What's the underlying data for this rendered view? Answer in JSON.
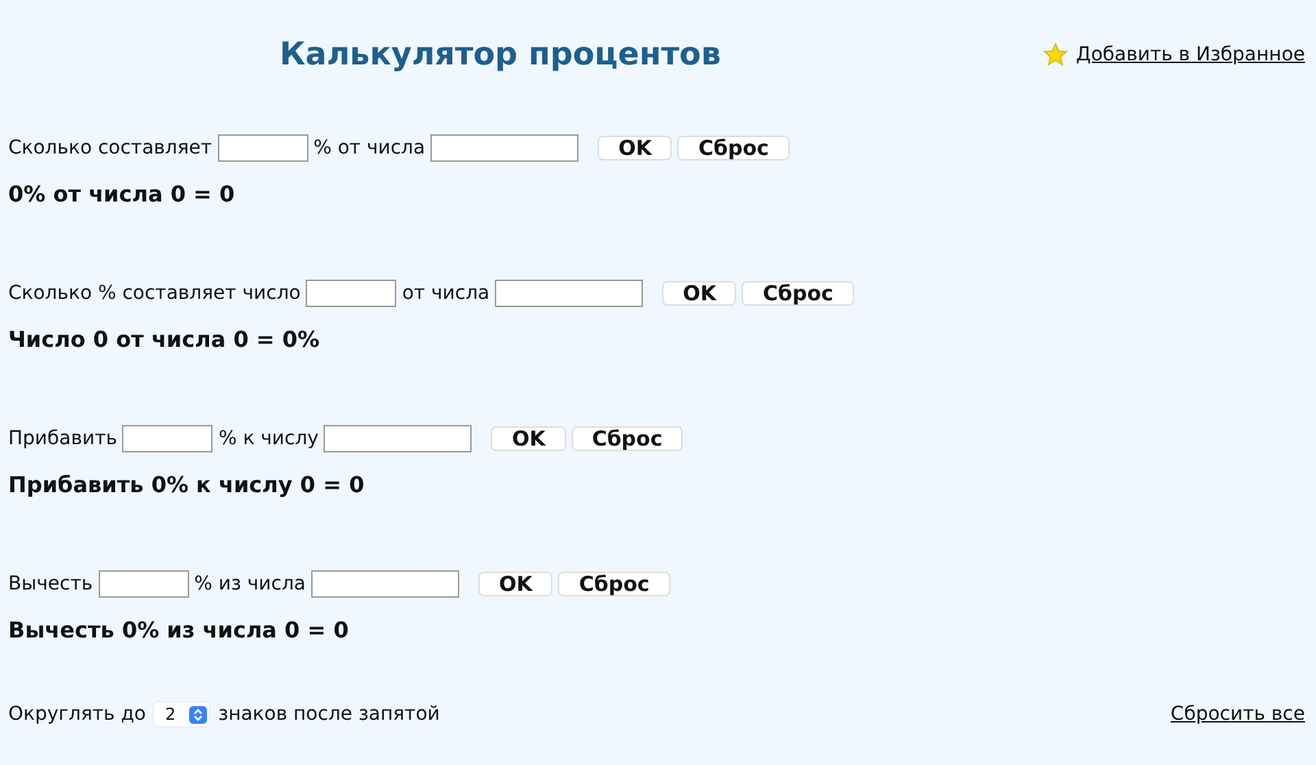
{
  "title": "Калькулятор процентов",
  "favorite_link": "Добавить в Избранное",
  "calculators": [
    {
      "label_before": "Сколько составляет",
      "label_middle": "% от числа",
      "ok_button": "OK",
      "reset_button": "Сброс",
      "result": "0% от числа 0 = 0"
    },
    {
      "label_before": "Сколько % составляет число",
      "label_middle": "от числа",
      "ok_button": "OK",
      "reset_button": "Сброс",
      "result": "Число 0 от числа 0 = 0%"
    },
    {
      "label_before": "Прибавить",
      "label_middle": "% к числу",
      "ok_button": "OK",
      "reset_button": "Сброс",
      "result": "Прибавить 0% к числу 0 = 0"
    },
    {
      "label_before": "Вычесть",
      "label_middle": "% из числа",
      "ok_button": "OK",
      "reset_button": "Сброс",
      "result": "Вычесть 0% из числа 0 = 0"
    }
  ],
  "rounding": {
    "label_before": "Округлять до",
    "value": "2",
    "label_after": "знаков после запятой"
  },
  "reset_all_link": "Сбросить все"
}
